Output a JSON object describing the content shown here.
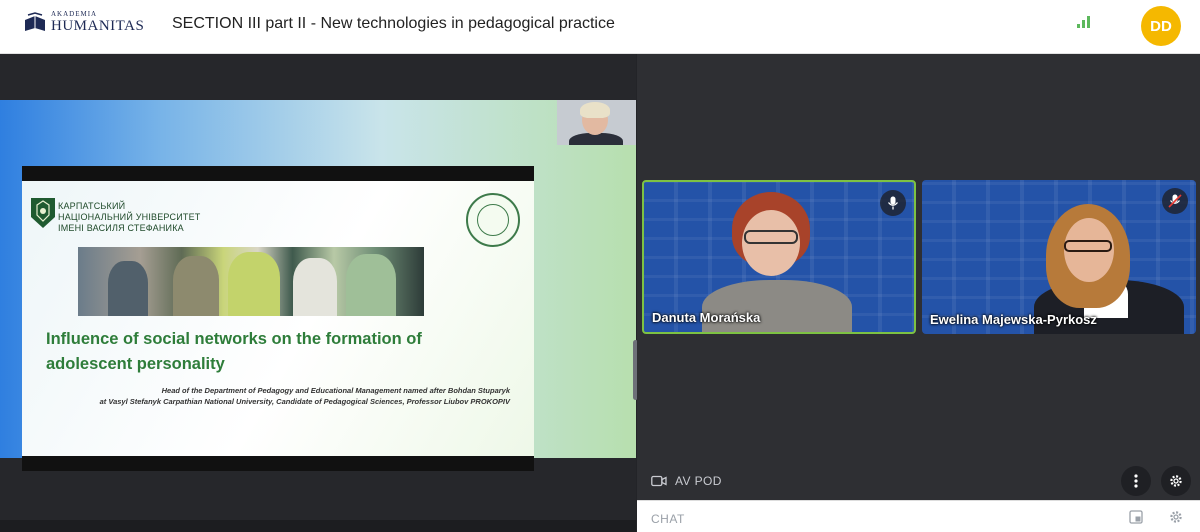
{
  "header": {
    "logo_small": "AKADEMIA",
    "logo_big": "HUMANITAS",
    "title": "SECTION III part II - New technologies in pedagogical practice",
    "avatar_initials": "DD",
    "signal_icon": "signal-bars-icon"
  },
  "slide": {
    "university_line1": "КАРПАТСЬКИЙ",
    "university_line2": "НАЦІОНАЛЬНИЙ УНІВЕРСИТЕТ",
    "university_line3": "ІМЕНІ ВАСИЛЯ СТЕФАНИКА",
    "heading": "Influence of social networks on the formation of adolescent personality",
    "subtitle_line1": "Head of the Department of Pedagogy and Educational Management named after Bohdan Stuparyk",
    "subtitle_line2": "at Vasyl Stefanyk Carpathian National University, Candidate of Pedagogical Sciences, Professor Liubov PROKOPIV"
  },
  "participants": [
    {
      "name": "Danuta Morańska",
      "active": true,
      "mic_icon": "microphone-icon"
    },
    {
      "name": "Ewelina Majewska-Pyrkosz",
      "active": false,
      "mic_icon": "microphone-muted-icon"
    }
  ],
  "bottom_bar": {
    "avpod_label": "AV POD",
    "chat_label": "CHAT"
  },
  "colors": {
    "accent_green": "#7dc243",
    "avatar_yellow": "#f5b800",
    "tile_blue": "#2453a8",
    "slide_heading_green": "#2e7d3a"
  }
}
